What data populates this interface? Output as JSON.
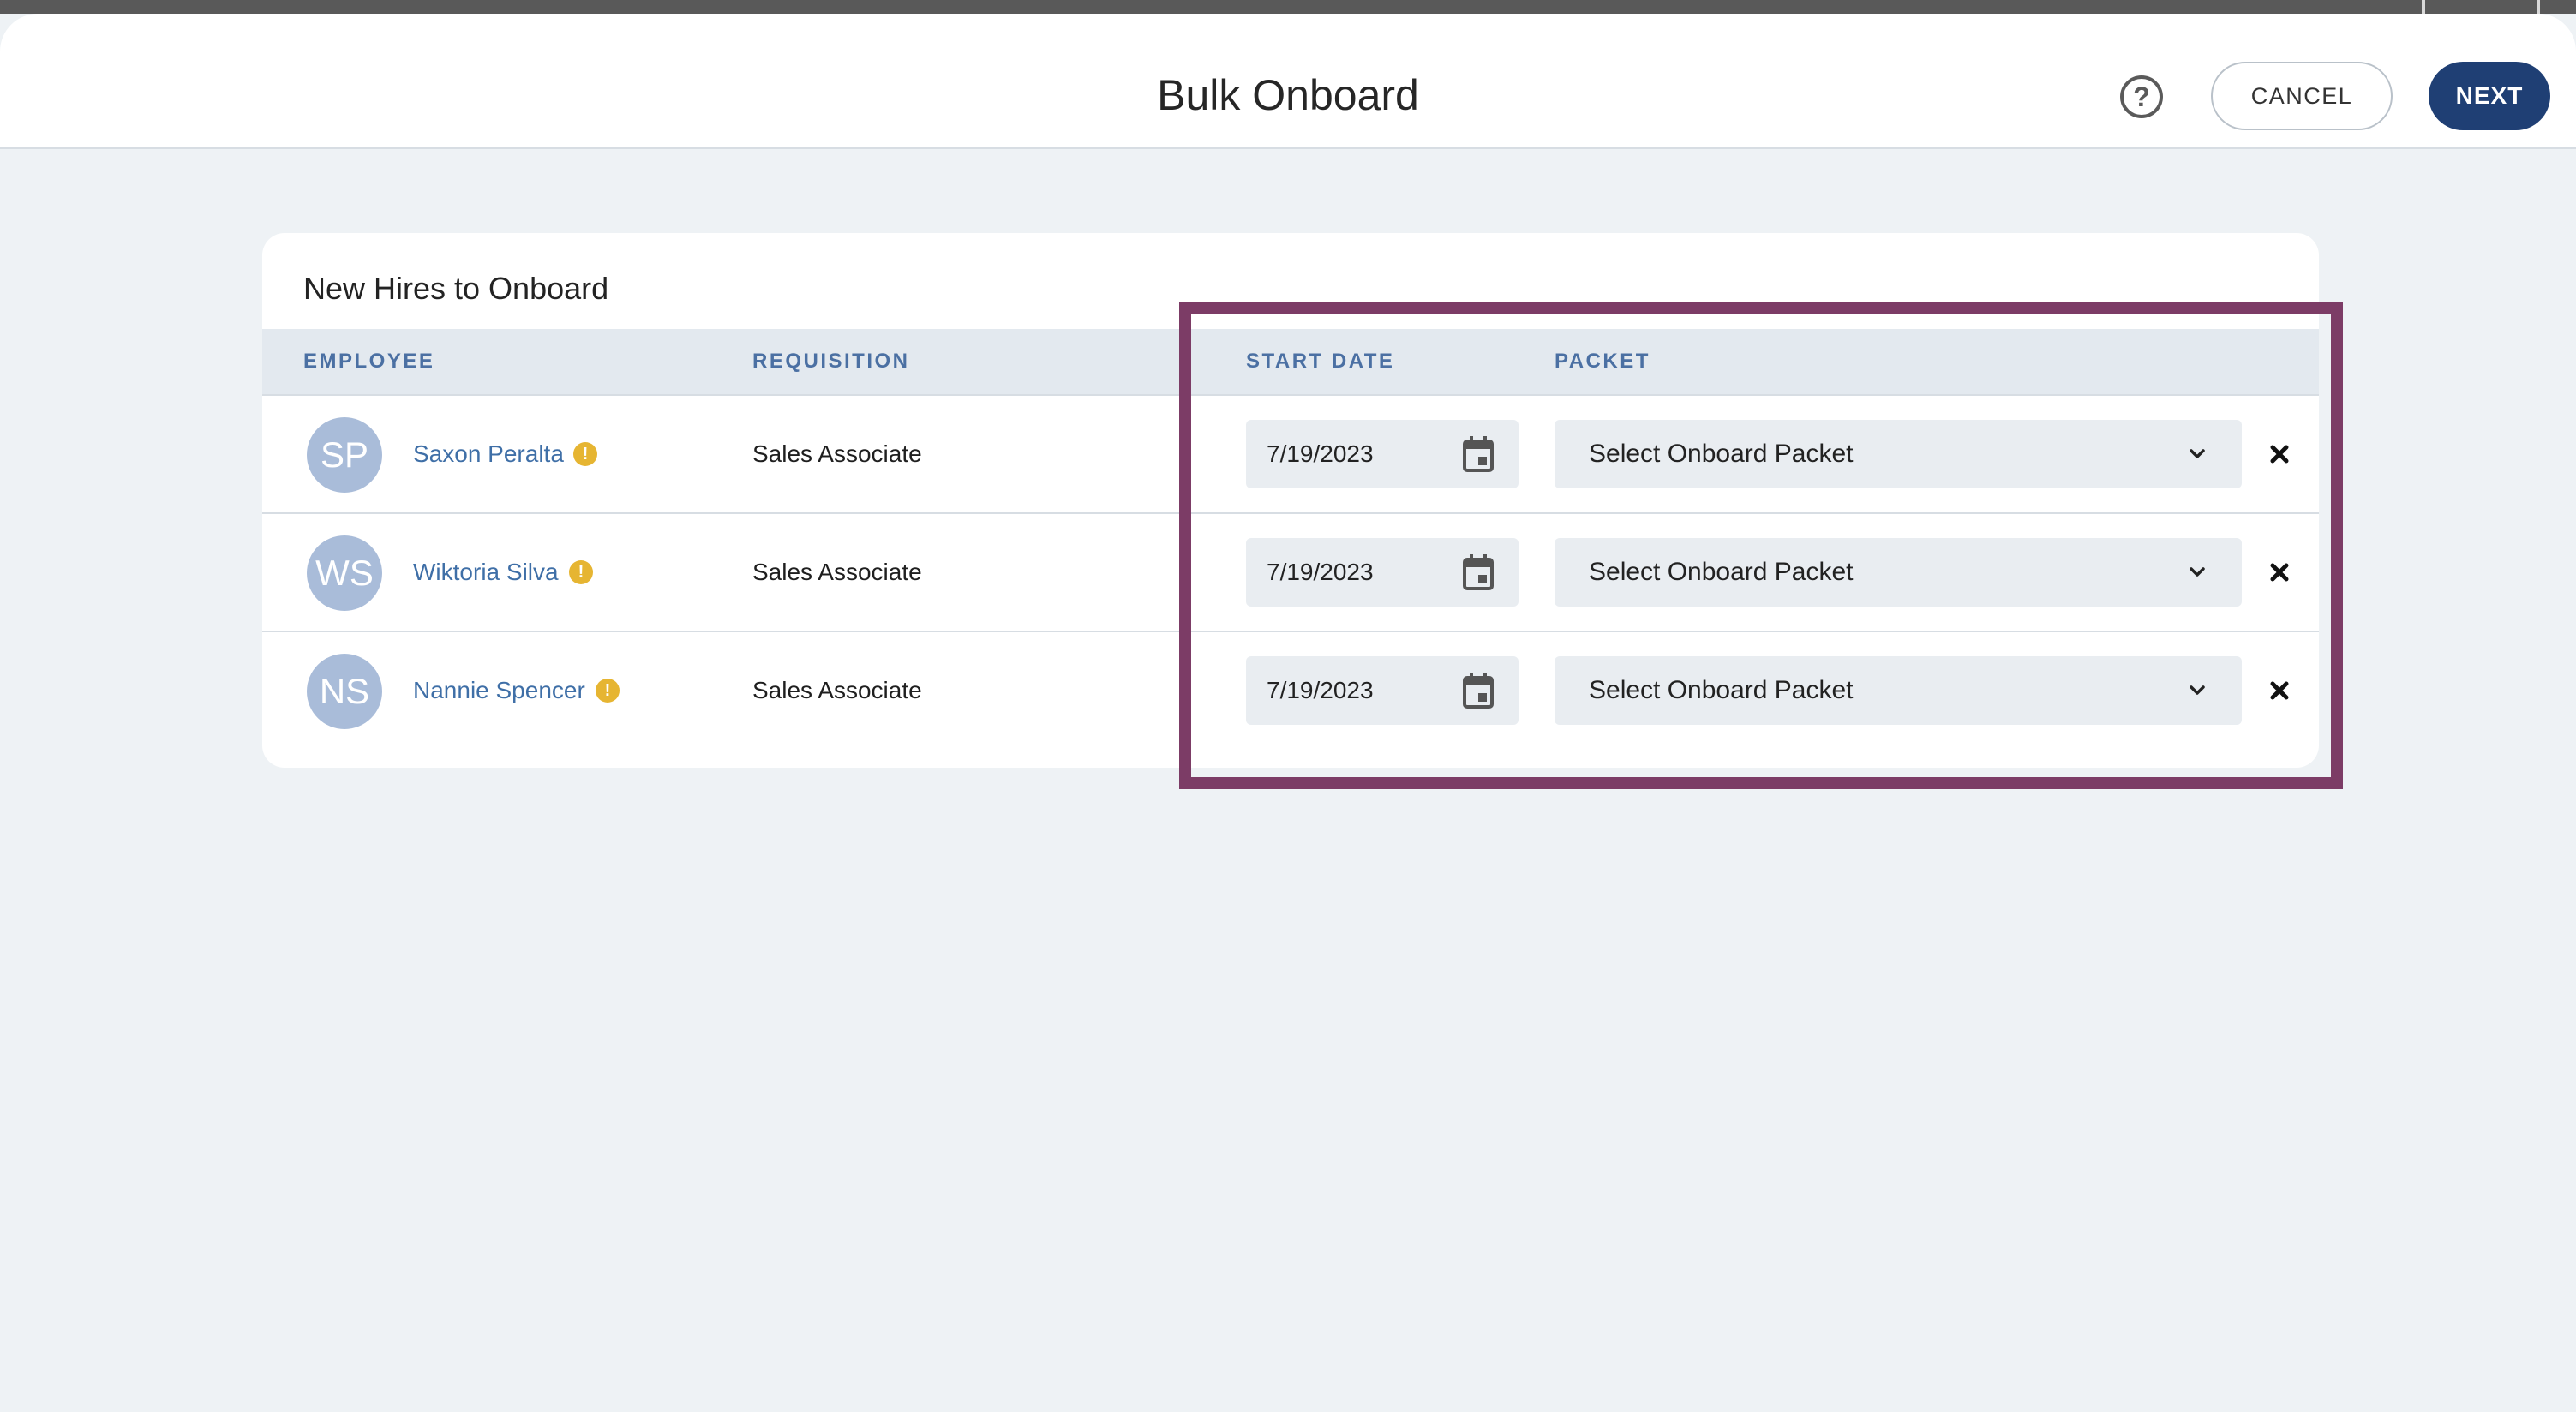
{
  "header": {
    "title": "Bulk Onboard",
    "help_icon": "help-circle-icon",
    "help_glyph": "?",
    "cancel_label": "CANCEL",
    "next_label": "NEXT"
  },
  "card": {
    "title": "New Hires to Onboard",
    "columns": {
      "employee": "EMPLOYEE",
      "requisition": "REQUISITION",
      "start_date": "START DATE",
      "packet": "PACKET"
    },
    "rows": [
      {
        "initials": "SP",
        "name": "Saxon Peralta",
        "warning_glyph": "!",
        "requisition": "Sales Associate",
        "start_date": "7/19/2023",
        "packet": "Select Onboard Packet"
      },
      {
        "initials": "WS",
        "name": "Wiktoria Silva",
        "warning_glyph": "!",
        "requisition": "Sales Associate",
        "start_date": "7/19/2023",
        "packet": "Select Onboard Packet"
      },
      {
        "initials": "NS",
        "name": "Nannie Spencer",
        "warning_glyph": "!",
        "requisition": "Sales Associate",
        "start_date": "7/19/2023",
        "packet": "Select Onboard Packet"
      }
    ]
  },
  "icons": {
    "row_actions": [
      "warning-icon",
      "calendar-icon",
      "chevron-down-icon",
      "close-icon"
    ]
  },
  "colors": {
    "brand": "#1f3f74",
    "link": "#3f6fa7",
    "column_header": "#4b70a3",
    "avatar": "#a9bcd9",
    "warning": "#e6b532",
    "highlight": "#7c3c66",
    "background": "#eef2f5"
  }
}
